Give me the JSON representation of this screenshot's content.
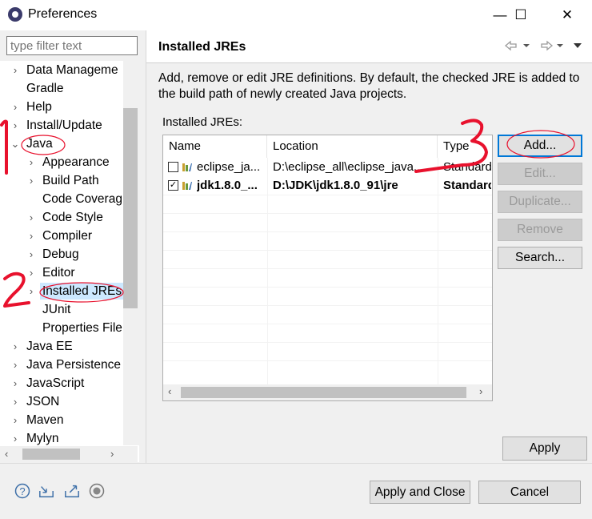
{
  "window": {
    "title": "Preferences",
    "minimize_glyph": "—",
    "maximize_glyph": "☐",
    "close_glyph": "✕"
  },
  "filter": {
    "placeholder": "type filter text"
  },
  "tree": {
    "items": [
      {
        "label": "Data Manageme",
        "expander": "›",
        "level": 0
      },
      {
        "label": "Gradle",
        "expander": "",
        "level": 0
      },
      {
        "label": "Help",
        "expander": "›",
        "level": 0
      },
      {
        "label": "Install/Update",
        "expander": "›",
        "level": 0
      },
      {
        "label": "Java",
        "expander": "⌄",
        "level": 0
      },
      {
        "label": "Appearance",
        "expander": "›",
        "level": 1
      },
      {
        "label": "Build Path",
        "expander": "›",
        "level": 1
      },
      {
        "label": "Code Coverag",
        "expander": "",
        "level": 1
      },
      {
        "label": "Code Style",
        "expander": "›",
        "level": 1
      },
      {
        "label": "Compiler",
        "expander": "›",
        "level": 1
      },
      {
        "label": "Debug",
        "expander": "›",
        "level": 1
      },
      {
        "label": "Editor",
        "expander": "›",
        "level": 1
      },
      {
        "label": "Installed JREs",
        "expander": "›",
        "level": 1,
        "selected": true
      },
      {
        "label": "JUnit",
        "expander": "",
        "level": 1
      },
      {
        "label": "Properties File",
        "expander": "",
        "level": 1
      },
      {
        "label": "Java EE",
        "expander": "›",
        "level": 0
      },
      {
        "label": "Java Persistence",
        "expander": "›",
        "level": 0
      },
      {
        "label": "JavaScript",
        "expander": "›",
        "level": 0
      },
      {
        "label": "JSON",
        "expander": "›",
        "level": 0
      },
      {
        "label": "Maven",
        "expander": "›",
        "level": 0
      },
      {
        "label": "Mylyn",
        "expander": "›",
        "level": 0
      }
    ]
  },
  "page": {
    "title": "Installed JREs",
    "description": "Add, remove or edit JRE definitions. By default, the checked JRE is added to the build path of newly created Java projects.",
    "list_label": "Installed JREs:",
    "columns": [
      "Name",
      "Location",
      "Type"
    ],
    "rows": [
      {
        "name": "eclipse_ja...",
        "location": "D:\\eclipse_all\\eclipse_java...",
        "type": "Standard",
        "checked": false,
        "check_glyph": "",
        "bold": false
      },
      {
        "name": "jdk1.8.0_...",
        "location": "D:\\JDK\\jdk1.8.0_91\\jre",
        "type": "Standard",
        "checked": true,
        "check_glyph": "✓",
        "bold": true
      }
    ],
    "buttons": {
      "add": "Add...",
      "edit": "Edit...",
      "duplicate": "Duplicate...",
      "remove": "Remove",
      "search": "Search..."
    },
    "apply": "Apply"
  },
  "footer": {
    "apply_close": "Apply and Close",
    "cancel": "Cancel"
  },
  "annotations": [
    "1",
    "2",
    "3"
  ],
  "colors": {
    "annotation_red": "#e8112d",
    "selection": "#cce8ff"
  }
}
